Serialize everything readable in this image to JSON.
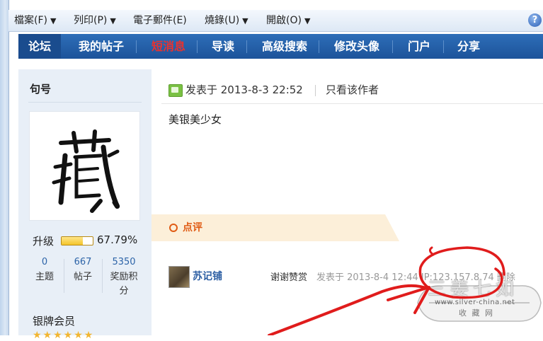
{
  "menu": {
    "items": [
      {
        "label": "檔案(F)",
        "has_caret": true
      },
      {
        "label": "列印(P)",
        "has_caret": true
      },
      {
        "label": "電子郵件(E)",
        "has_caret": false
      },
      {
        "label": "燒錄(U)",
        "has_caret": true
      },
      {
        "label": "開啟(O)",
        "has_caret": true
      }
    ],
    "help_label": "?"
  },
  "nav": {
    "tabs": [
      {
        "label": "论坛",
        "active": true
      },
      {
        "label": "我的帖子"
      },
      {
        "label": "短消息",
        "color": "#e8322f"
      },
      {
        "label": "导读"
      },
      {
        "label": "高级搜索"
      },
      {
        "label": "修改头像"
      },
      {
        "label": "门户"
      },
      {
        "label": "分享"
      }
    ]
  },
  "profile": {
    "username": "句号",
    "avatar_icon": "calligraphy-avatar",
    "level_label": "升级",
    "level_percent": "67.79%",
    "level_fraction": 0.6779,
    "stats": [
      {
        "value": "0",
        "label": "主题"
      },
      {
        "value": "667",
        "label": "帖子"
      },
      {
        "value": "5350",
        "label": "奖励积分"
      }
    ],
    "rank": "银牌会员",
    "stars": "★★★★★★"
  },
  "post": {
    "date_text": "发表于 2013-8-3 22:52",
    "author_only": "只看该作者",
    "body": "美银美少女"
  },
  "comments": {
    "section_title": "点评",
    "items": [
      {
        "user": "苏记铺",
        "text": "谢谢赞赏",
        "meta": "发表于 2013-8-4 12:44 IP:123.157.8.74 删除"
      }
    ]
  },
  "watermark": {
    "top_text": "三姜七如",
    "url": "www.silver-china.net",
    "bottom_text": "收 藏 网"
  },
  "colors": {
    "nav_bg": "#2166b0",
    "sidebar_bg": "#e8eff7",
    "link": "#2d64a8",
    "annotation": "#e01c1c",
    "comment_accent": "#e05b14",
    "comment_bar": "#fcefd9"
  }
}
